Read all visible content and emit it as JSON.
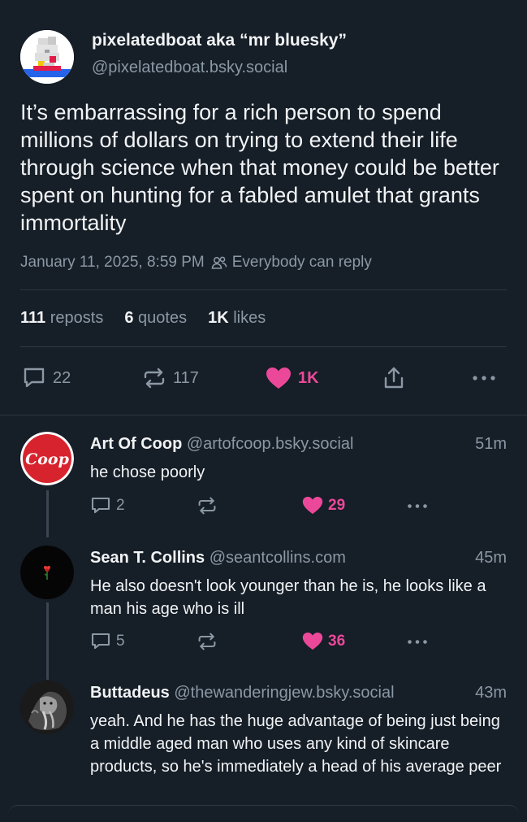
{
  "post": {
    "display_name": "pixelatedboat aka “mr bluesky”",
    "handle": "@pixelatedboat.bsky.social",
    "text": "It’s embarrassing for a rich person to spend millions of dollars on trying to extend their life through science when that money could be better spent on hunting for a fabled amulet that grants immortality",
    "date": "January 11, 2025, 8:59 PM",
    "reply_setting": "Everybody can reply",
    "stats": {
      "reposts_count": "111",
      "reposts_label": "reposts",
      "quotes_count": "6",
      "quotes_label": "quotes",
      "likes_count": "1K",
      "likes_label": "likes"
    },
    "actions": {
      "reply_count": "22",
      "repost_count": "117",
      "like_count": "1K"
    }
  },
  "replies": [
    {
      "display_name": "Art Of Coop",
      "handle": "@artofcoop.bsky.social",
      "time": "51m",
      "avatar_text": "Coop",
      "text": "he chose poorly",
      "reply_count": "2",
      "like_count": "29"
    },
    {
      "display_name": "Sean T. Collins",
      "handle": "@seantcollins.com",
      "time": "45m",
      "text": "He also doesn't look younger than he is, he looks like a man his age who is ill",
      "reply_count": "5",
      "like_count": "36"
    },
    {
      "display_name": "Buttadeus",
      "handle": "@thewanderingjew.bsky.social",
      "time": "43m",
      "text": "yeah. And he has the huge advantage of being just being a middle aged man who uses any kind of skincare products, so he's immediately a head of his average peer"
    }
  ],
  "colors": {
    "background": "#161e27",
    "like_pink": "#ec4899",
    "muted": "#8b98a5"
  },
  "icons": [
    "people-icon",
    "reply-icon",
    "repost-icon",
    "heart-icon",
    "share-icon",
    "more-icon"
  ]
}
